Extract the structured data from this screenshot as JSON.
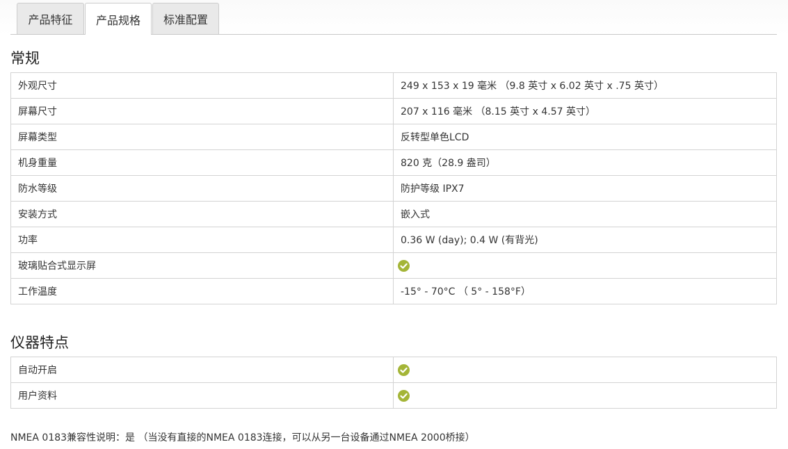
{
  "tabs": [
    "产品特征",
    "产品规格",
    "标准配置"
  ],
  "sections": [
    {
      "title": "常规",
      "rows": [
        {
          "label": "外观尺寸",
          "value": "249 x 153 x 19 毫米 （9.8 英寸 x 6.02 英寸 x .75 英寸）"
        },
        {
          "label": "屏幕尺寸",
          "value": "207 x 116 毫米 （8.15 英寸 x 4.57 英寸）"
        },
        {
          "label": "屏幕类型",
          "value": "反转型单色LCD"
        },
        {
          "label": "机身重量",
          "value": "820 克（28.9 盎司）"
        },
        {
          "label": "防水等级",
          "value": "防护等级 IPX7"
        },
        {
          "label": "安装方式",
          "value": "嵌入式"
        },
        {
          "label": "功率",
          "value": "0.36 W (day); 0.4 W (有背光)"
        },
        {
          "label": "玻璃贴合式显示屏",
          "value": "check"
        },
        {
          "label": "工作温度",
          "value": "-15° - 70°C （ 5° - 158°F）"
        }
      ]
    },
    {
      "title": "仪器特点",
      "rows": [
        {
          "label": "自动开启",
          "value": "check"
        },
        {
          "label": "用户资料",
          "value": "check"
        }
      ]
    }
  ],
  "note": "NMEA 0183兼容性说明：是 （当没有直接的NMEA 0183连接，可以从另一台设备通过NMEA 2000桥接）",
  "colors": {
    "check": "#a4b537",
    "border": "#d3d3d3",
    "tab_bg": "#e9e9e9"
  },
  "icons": {
    "check": "check-circle-icon"
  }
}
